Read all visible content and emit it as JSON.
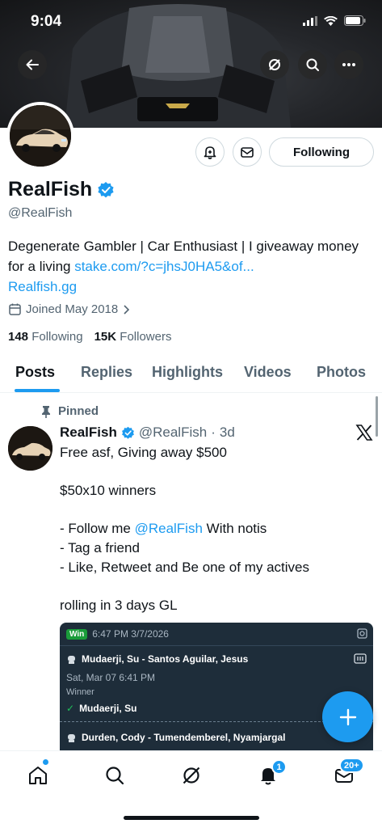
{
  "status_bar": {
    "time": "9:04"
  },
  "profile": {
    "display_name": "RealFish",
    "handle": "@RealFish",
    "bio_text": "Degenerate Gambler | Car Enthusiast | I giveaway money for a living ",
    "bio_link": "stake.com/?c=jhsJ0HA5&of...",
    "website": "Realfish.gg",
    "joined": "Joined May 2018",
    "following_count": "148",
    "following_label": "Following",
    "followers_count": "15K",
    "followers_label": "Followers",
    "follow_button": "Following"
  },
  "tabs": [
    {
      "label": "Posts",
      "active": true
    },
    {
      "label": "Replies",
      "active": false
    },
    {
      "label": "Highlights",
      "active": false
    },
    {
      "label": "Videos",
      "active": false
    },
    {
      "label": "Photos",
      "active": false
    }
  ],
  "post": {
    "pinned_label": "Pinned",
    "author_name": "RealFish",
    "author_handle": "@RealFish",
    "separator": "·",
    "time": "3d",
    "text_before": "Free asf,  Giving away $500\n\n$50x10 winners\n\n- Follow me ",
    "mention": "@RealFish",
    "text_after": " With notis\n- Tag a friend\n- Like, Retweet and   Be one of my actives\n\nrolling in 3 days GL"
  },
  "bet_card": {
    "badge": "Win",
    "timestamp": "6:47 PM 3/7/2026",
    "match1": "Mudaerji, Su - Santos Aguilar, Jesus",
    "match1_date": "Sat, Mar 07  6:41 PM",
    "winner_label": "Winner",
    "winner_name": "Mudaerji, Su",
    "match2": "Durden, Cody - Tumendemberel, Nyamjargal"
  },
  "bottom_nav": {
    "notifications_badge": "1",
    "messages_badge": "20+"
  },
  "colors": {
    "accent": "#1d9bf0",
    "text": "#0f1419",
    "muted": "#536471",
    "card_bg": "#1e2d3a",
    "win_green": "#1a9c3a"
  }
}
